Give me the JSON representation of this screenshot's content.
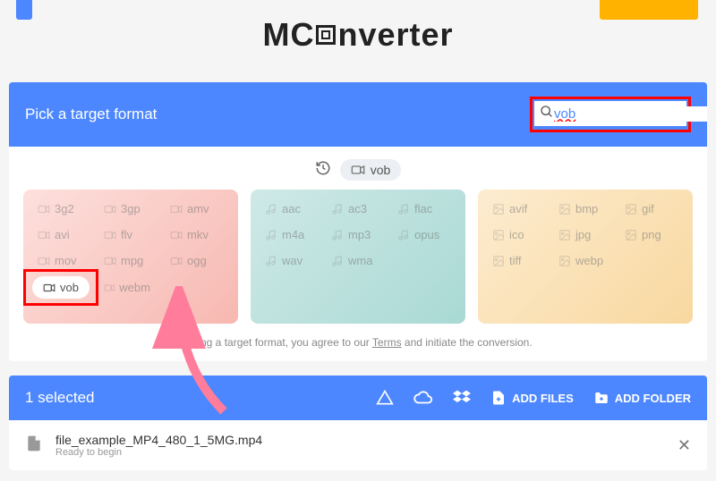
{
  "brand": {
    "part1": "MC",
    "part2": "nverter"
  },
  "header": {
    "title": "Pick a target format"
  },
  "search": {
    "value": "vob"
  },
  "recent": {
    "label": "vob"
  },
  "panels": {
    "video": [
      "3g2",
      "3gp",
      "amv",
      "avi",
      "flv",
      "mkv",
      "mov",
      "mpg",
      "ogg",
      "vob",
      "webm"
    ],
    "audio": [
      "aac",
      "ac3",
      "flac",
      "m4a",
      "mp3",
      "opus",
      "wav",
      "wma"
    ],
    "image": [
      "avif",
      "bmp",
      "gif",
      "ico",
      "jpg",
      "png",
      "tiff",
      "webp"
    ]
  },
  "highlight": "vob",
  "terms": {
    "prefix": "ecting a target format, you agree to our ",
    "link": "Terms",
    "suffix": " and initiate the conversion."
  },
  "selection": {
    "count": "1 selected"
  },
  "actions": {
    "add_files": "ADD FILES",
    "add_folder": "ADD FOLDER"
  },
  "file": {
    "name": "file_example_MP4_480_1_5MG.mp4",
    "status": "Ready to begin"
  }
}
